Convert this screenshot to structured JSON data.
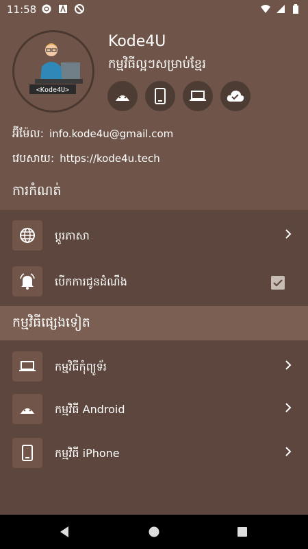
{
  "status": {
    "time": "11:58"
  },
  "profile": {
    "app_name": "Kode4U",
    "tagline": "កម្មវិធីល្អៗសម្រាប់ខ្មែរ",
    "avatar_caption": "<Kode4U>",
    "platforms": [
      "android-icon",
      "phone-icon",
      "laptop-icon",
      "cloud-check-icon"
    ]
  },
  "contact": {
    "email_label": "អ៊ីម៉ែល:",
    "email": "info.kode4u@gmail.com",
    "web_label": "វេបសាយ:",
    "web": "https://kode4u.tech"
  },
  "settings": {
    "title": "ការកំណត់",
    "items": [
      {
        "label": "ប្តូរភាសា",
        "icon": "globe-icon"
      },
      {
        "label": "បើកការជូនដំណឹង",
        "icon": "bell-icon",
        "checked": true
      }
    ]
  },
  "more_apps": {
    "title": "កម្មវិធីផ្សេងទៀត",
    "items": [
      {
        "label": "កម្មវិធីកុំព្យូទ័រ",
        "icon": "laptop-icon"
      },
      {
        "label": "កម្មវិធី Android",
        "icon": "android-icon"
      },
      {
        "label": "កម្មវិធី iPhone",
        "icon": "phone-icon"
      }
    ]
  },
  "colors": {
    "background": "#6f5549",
    "panel": "#5c463d",
    "icon_button": "#4d3c34",
    "accent_check": "#c9bcb5"
  }
}
